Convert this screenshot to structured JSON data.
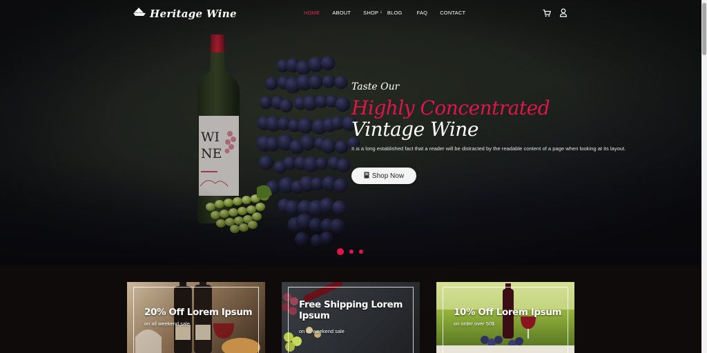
{
  "brand": {
    "name": "Heritage Wine",
    "logo_icon": "ship-icon"
  },
  "nav": {
    "items": [
      {
        "label": "HOME",
        "active": true
      },
      {
        "label": "ABOUT",
        "active": false
      },
      {
        "label": "SHOP",
        "active": false,
        "dropdown": true
      },
      {
        "label": "BLOG",
        "active": false
      },
      {
        "label": "FAQ",
        "active": false
      },
      {
        "label": "CONTACT",
        "active": false
      }
    ],
    "icons": [
      "cart-icon",
      "user-icon"
    ]
  },
  "hero": {
    "eyebrow": "Taste Our",
    "headline_accent": "Highly Concentrated",
    "headline": "Vintage Wine",
    "description": "It is a long established fact that a reader will be distracted by the readable content of a page when looking at its layout.",
    "button_label": "Shop Now",
    "bottle_label": {
      "title": "WI NE"
    },
    "slider": {
      "count": 3,
      "active_index": 0
    }
  },
  "promos": [
    {
      "title": "20% Off Lorem Ipsum",
      "subtitle": "on all weekend sale"
    },
    {
      "title": "Free Shipping Lorem Ipsum",
      "subtitle": "on all weekend sale"
    },
    {
      "title": "10% Off Lorem Ipsum",
      "subtitle": "on order over 50$"
    }
  ],
  "colors": {
    "accent": "#e0154a",
    "background": "#0f0b0a",
    "button": "#f4f4f4"
  }
}
